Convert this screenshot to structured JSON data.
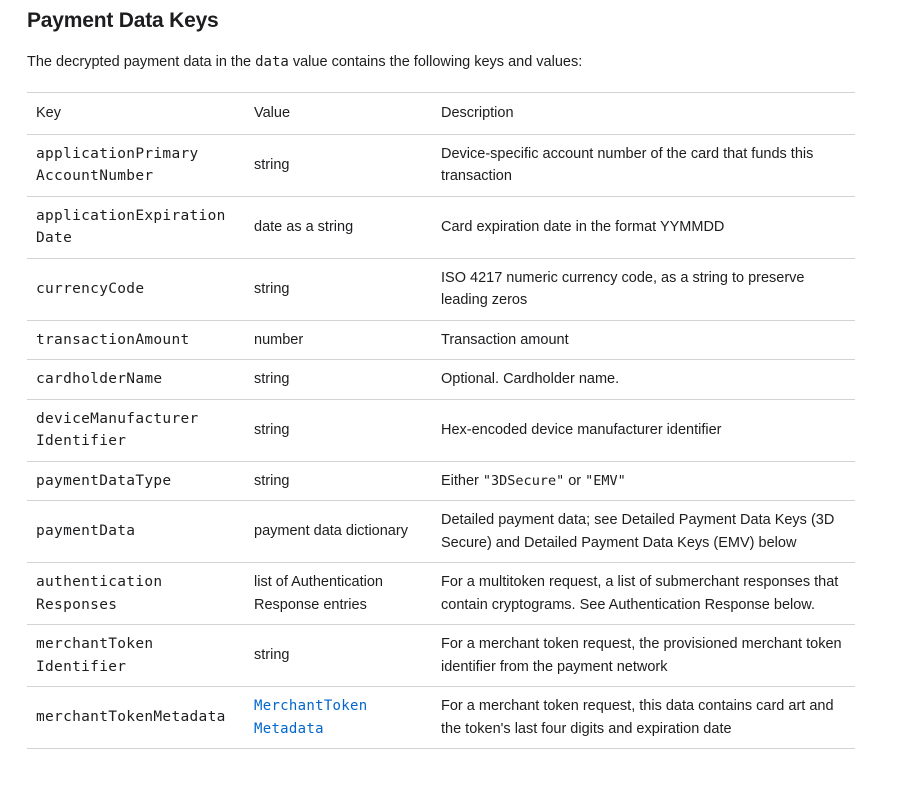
{
  "heading": "Payment Data Keys",
  "intro": {
    "before": "The decrypted payment data in the ",
    "code": "data",
    "after": " value contains the following keys and values:"
  },
  "table": {
    "headers": [
      "Key",
      "Value",
      "Description"
    ],
    "rows": [
      {
        "key_line1": "applicationPrimary",
        "key_line2": "AccountNumber",
        "value": "string",
        "description": "Device-specific account number of the card that funds this transaction"
      },
      {
        "key_line1": "applicationExpiration",
        "key_line2": "Date",
        "value": "date as a string",
        "description": "Card expiration date in the format YYMMDD"
      },
      {
        "key_line1": "currencyCode",
        "value": "string",
        "description": "ISO 4217 numeric currency code, as a string to preserve leading zeros"
      },
      {
        "key_line1": "transactionAmount",
        "value": "number",
        "description": "Transaction amount"
      },
      {
        "key_line1": "cardholderName",
        "value": "string",
        "description": "Optional. Cardholder name."
      },
      {
        "key_line1": "deviceManufacturer",
        "key_line2": "Identifier",
        "value": "string",
        "description": "Hex-encoded device manufacturer identifier"
      },
      {
        "key_line1": "paymentDataType",
        "value": "string",
        "description_before": "Either ",
        "description_code1": "\"3DSecure\"",
        "description_mid": " or ",
        "description_code2": "\"EMV\""
      },
      {
        "key_line1": "paymentData",
        "value": "payment data dictionary",
        "description": "Detailed payment data; see Detailed Payment Data Keys (3D Secure) and Detailed Payment Data Keys (EMV) below"
      },
      {
        "key_line1": "authentication",
        "key_line2": "Responses",
        "value_line1": "list of Authentication",
        "value_line2": "Response entries",
        "description": "For a multitoken request, a list of submerchant responses that contain cryptograms. See Authentication Response below."
      },
      {
        "key_line1": "merchantToken",
        "key_line2": "Identifier",
        "value": "string",
        "description": "For a merchant token request, the provisioned merchant token identifier from the payment network"
      },
      {
        "key_line1": "merchantTokenMetadata",
        "value_link_line1": "MerchantToken",
        "value_link_line2": "Metadata",
        "description": "For a merchant token request, this data contains card art and the token's last four digits and expiration date"
      }
    ]
  }
}
